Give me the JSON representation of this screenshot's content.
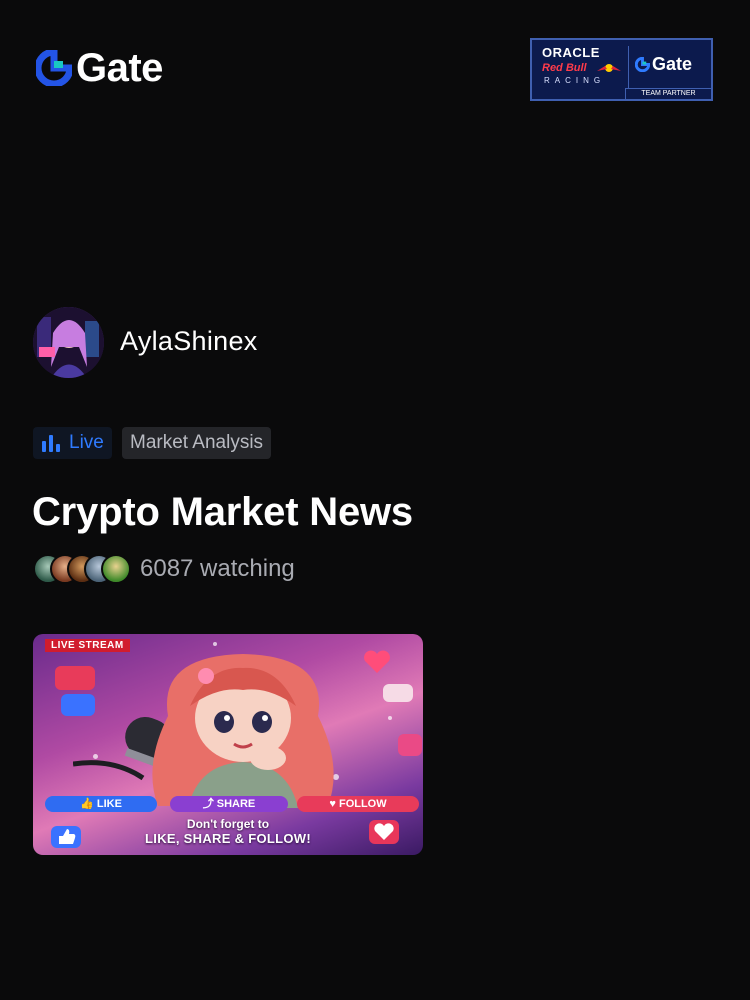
{
  "header": {
    "brand_name": "Gate",
    "brand_color": "#2354e6",
    "brand_accent": "#19c8c2",
    "partner_badge": {
      "line1": "ORACLE",
      "line2": "Red Bull",
      "line3": "RACING",
      "partner_brand": "Gate",
      "tag": "TEAM PARTNER"
    }
  },
  "streamer": {
    "name": "AylaShinex",
    "avatar_icon": "avatar-image"
  },
  "tags": {
    "live_label": "Live",
    "live_color": "#2f7bff",
    "category": "Market Analysis"
  },
  "stream": {
    "title": "Crypto Market News",
    "watching_text": "6087 watching"
  },
  "thumbnail": {
    "badge": "LIVE STREAM",
    "like_label": "LIKE",
    "share_label": "SHARE",
    "follow_label": "FOLLOW",
    "caption_line1": "Don't forget to",
    "caption_line2": "LIKE, SHARE & FOLLOW!"
  }
}
